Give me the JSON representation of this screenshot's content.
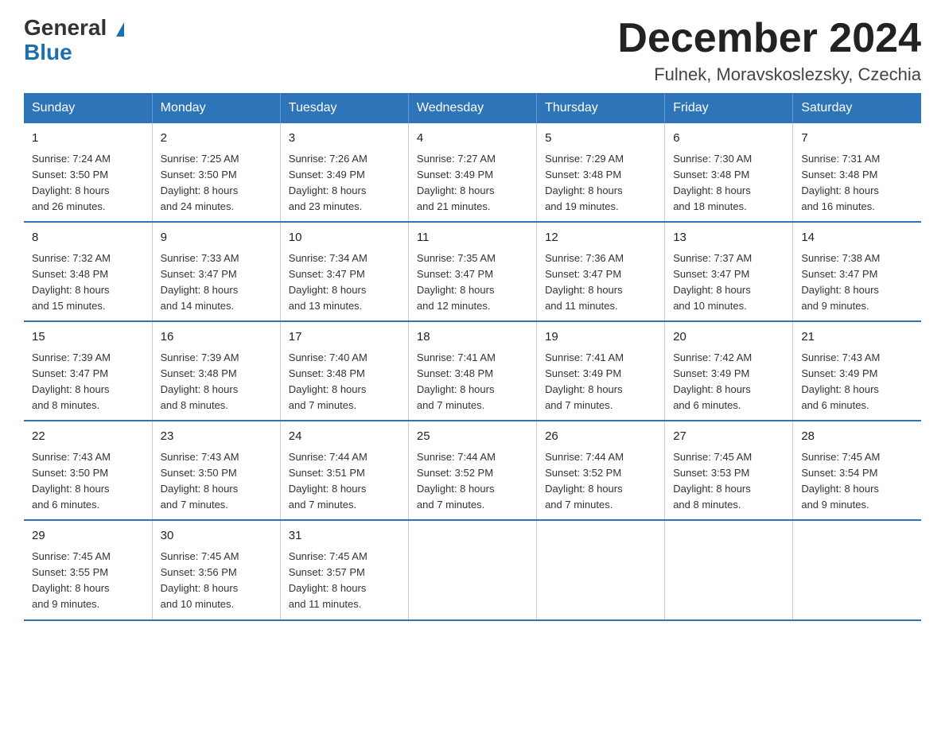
{
  "header": {
    "logo_general": "General",
    "logo_blue": "Blue",
    "month_title": "December 2024",
    "location": "Fulnek, Moravskoslezsky, Czechia"
  },
  "days_of_week": [
    "Sunday",
    "Monday",
    "Tuesday",
    "Wednesday",
    "Thursday",
    "Friday",
    "Saturday"
  ],
  "weeks": [
    [
      {
        "day": "1",
        "sunrise": "7:24 AM",
        "sunset": "3:50 PM",
        "daylight": "8 hours and 26 minutes."
      },
      {
        "day": "2",
        "sunrise": "7:25 AM",
        "sunset": "3:50 PM",
        "daylight": "8 hours and 24 minutes."
      },
      {
        "day": "3",
        "sunrise": "7:26 AM",
        "sunset": "3:49 PM",
        "daylight": "8 hours and 23 minutes."
      },
      {
        "day": "4",
        "sunrise": "7:27 AM",
        "sunset": "3:49 PM",
        "daylight": "8 hours and 21 minutes."
      },
      {
        "day": "5",
        "sunrise": "7:29 AM",
        "sunset": "3:48 PM",
        "daylight": "8 hours and 19 minutes."
      },
      {
        "day": "6",
        "sunrise": "7:30 AM",
        "sunset": "3:48 PM",
        "daylight": "8 hours and 18 minutes."
      },
      {
        "day": "7",
        "sunrise": "7:31 AM",
        "sunset": "3:48 PM",
        "daylight": "8 hours and 16 minutes."
      }
    ],
    [
      {
        "day": "8",
        "sunrise": "7:32 AM",
        "sunset": "3:48 PM",
        "daylight": "8 hours and 15 minutes."
      },
      {
        "day": "9",
        "sunrise": "7:33 AM",
        "sunset": "3:47 PM",
        "daylight": "8 hours and 14 minutes."
      },
      {
        "day": "10",
        "sunrise": "7:34 AM",
        "sunset": "3:47 PM",
        "daylight": "8 hours and 13 minutes."
      },
      {
        "day": "11",
        "sunrise": "7:35 AM",
        "sunset": "3:47 PM",
        "daylight": "8 hours and 12 minutes."
      },
      {
        "day": "12",
        "sunrise": "7:36 AM",
        "sunset": "3:47 PM",
        "daylight": "8 hours and 11 minutes."
      },
      {
        "day": "13",
        "sunrise": "7:37 AM",
        "sunset": "3:47 PM",
        "daylight": "8 hours and 10 minutes."
      },
      {
        "day": "14",
        "sunrise": "7:38 AM",
        "sunset": "3:47 PM",
        "daylight": "8 hours and 9 minutes."
      }
    ],
    [
      {
        "day": "15",
        "sunrise": "7:39 AM",
        "sunset": "3:47 PM",
        "daylight": "8 hours and 8 minutes."
      },
      {
        "day": "16",
        "sunrise": "7:39 AM",
        "sunset": "3:48 PM",
        "daylight": "8 hours and 8 minutes."
      },
      {
        "day": "17",
        "sunrise": "7:40 AM",
        "sunset": "3:48 PM",
        "daylight": "8 hours and 7 minutes."
      },
      {
        "day": "18",
        "sunrise": "7:41 AM",
        "sunset": "3:48 PM",
        "daylight": "8 hours and 7 minutes."
      },
      {
        "day": "19",
        "sunrise": "7:41 AM",
        "sunset": "3:49 PM",
        "daylight": "8 hours and 7 minutes."
      },
      {
        "day": "20",
        "sunrise": "7:42 AM",
        "sunset": "3:49 PM",
        "daylight": "8 hours and 6 minutes."
      },
      {
        "day": "21",
        "sunrise": "7:43 AM",
        "sunset": "3:49 PM",
        "daylight": "8 hours and 6 minutes."
      }
    ],
    [
      {
        "day": "22",
        "sunrise": "7:43 AM",
        "sunset": "3:50 PM",
        "daylight": "8 hours and 6 minutes."
      },
      {
        "day": "23",
        "sunrise": "7:43 AM",
        "sunset": "3:50 PM",
        "daylight": "8 hours and 7 minutes."
      },
      {
        "day": "24",
        "sunrise": "7:44 AM",
        "sunset": "3:51 PM",
        "daylight": "8 hours and 7 minutes."
      },
      {
        "day": "25",
        "sunrise": "7:44 AM",
        "sunset": "3:52 PM",
        "daylight": "8 hours and 7 minutes."
      },
      {
        "day": "26",
        "sunrise": "7:44 AM",
        "sunset": "3:52 PM",
        "daylight": "8 hours and 7 minutes."
      },
      {
        "day": "27",
        "sunrise": "7:45 AM",
        "sunset": "3:53 PM",
        "daylight": "8 hours and 8 minutes."
      },
      {
        "day": "28",
        "sunrise": "7:45 AM",
        "sunset": "3:54 PM",
        "daylight": "8 hours and 9 minutes."
      }
    ],
    [
      {
        "day": "29",
        "sunrise": "7:45 AM",
        "sunset": "3:55 PM",
        "daylight": "8 hours and 9 minutes."
      },
      {
        "day": "30",
        "sunrise": "7:45 AM",
        "sunset": "3:56 PM",
        "daylight": "8 hours and 10 minutes."
      },
      {
        "day": "31",
        "sunrise": "7:45 AM",
        "sunset": "3:57 PM",
        "daylight": "8 hours and 11 minutes."
      },
      null,
      null,
      null,
      null
    ]
  ],
  "labels": {
    "sunrise": "Sunrise:",
    "sunset": "Sunset:",
    "daylight": "Daylight:"
  }
}
